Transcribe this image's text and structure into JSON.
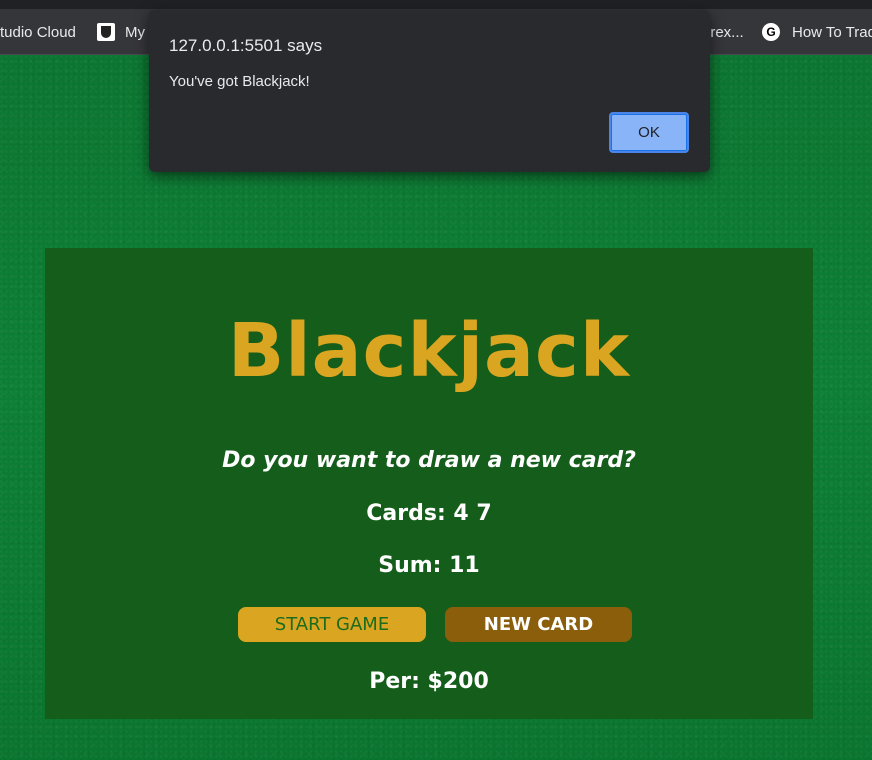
{
  "bookmarks": {
    "items": [
      {
        "label": "tudio Cloud",
        "icon": "none"
      },
      {
        "label": "My",
        "icon": "shield-icon"
      },
      {
        "label": "orex...",
        "icon": "none"
      },
      {
        "label": "How To Trad",
        "icon": "g-icon",
        "icon_letter": "G"
      }
    ]
  },
  "alert": {
    "title": "127.0.0.1:5501 says",
    "message": "You've got Blackjack!",
    "ok_label": "OK"
  },
  "game": {
    "title": "Blackjack",
    "message": "Do you want to draw a new card?",
    "cards_text": "Cards: 4 7",
    "sum_text": "Sum: 11",
    "start_label": "START GAME",
    "new_card_label": "NEW CARD",
    "player_text": "Per: $200"
  },
  "colors": {
    "felt": "#0c7a32",
    "panel": "#155d1a",
    "title_gold": "#daa520",
    "start_button": "#daa520",
    "new_card_button": "#8b5e0b",
    "dialog_bg": "#292a2d",
    "ok_button": "#8ab4f8"
  }
}
